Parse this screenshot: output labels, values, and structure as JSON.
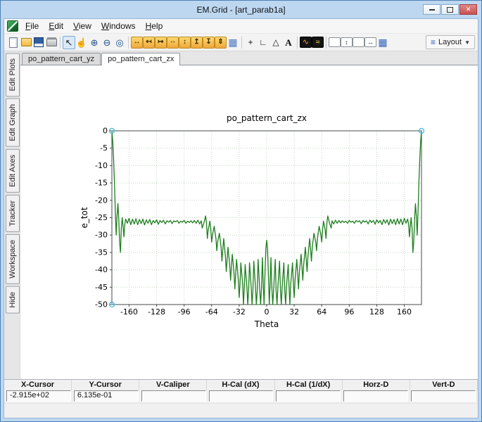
{
  "window": {
    "title": "EM.Grid - [art_parab1a]",
    "controls": {
      "minimize": "min",
      "restore": "restore",
      "close": "✕"
    }
  },
  "menu": {
    "items": [
      "File",
      "Edit",
      "View",
      "Windows",
      "Help"
    ]
  },
  "toolbar": {
    "groups": [
      [
        {
          "name": "new-document-icon",
          "kind": "page"
        },
        {
          "name": "open-folder-icon",
          "kind": "folder"
        },
        {
          "name": "save-icon",
          "kind": "floppy"
        },
        {
          "name": "print-icon",
          "kind": "printer"
        }
      ],
      [
        {
          "name": "select-arrow-icon",
          "glyph": "↖",
          "cls": "dark",
          "active": true
        },
        {
          "name": "pan-hand-icon",
          "glyph": "☝",
          "cls": "dark"
        },
        {
          "name": "zoom-in-icon",
          "glyph": "⊕",
          "cls": "blue"
        },
        {
          "name": "zoom-out-icon",
          "glyph": "⊖",
          "cls": "blue"
        },
        {
          "name": "zoom-window-icon",
          "glyph": "◎",
          "cls": "blue"
        }
      ],
      [
        {
          "name": "fit-x-icon",
          "glyph": "↔",
          "cls": "orange"
        },
        {
          "name": "shift-x-left-icon",
          "glyph": "↤",
          "cls": "orange"
        },
        {
          "name": "shift-x-right-icon",
          "glyph": "↦",
          "cls": "orange"
        },
        {
          "name": "expand-x-icon",
          "glyph": "⇔",
          "cls": "orange"
        },
        {
          "name": "fit-y-icon",
          "glyph": "↕",
          "cls": "orange"
        },
        {
          "name": "shift-y-up-icon",
          "glyph": "↥",
          "cls": "orange"
        },
        {
          "name": "shift-y-down-icon",
          "glyph": "↧",
          "cls": "orange"
        },
        {
          "name": "expand-y-icon",
          "glyph": "⇕",
          "cls": "orange"
        },
        {
          "name": "data-table-icon",
          "glyph": "▦",
          "cls": "table"
        }
      ],
      [
        {
          "name": "crosshair-icon",
          "glyph": "+",
          "cls": "plain"
        },
        {
          "name": "axes-icon",
          "glyph": "∟",
          "cls": "plain"
        },
        {
          "name": "marker-triangle-icon",
          "glyph": "△",
          "cls": "plain"
        },
        {
          "name": "text-annotation-icon",
          "glyph": "A",
          "cls": "serif"
        }
      ],
      [
        {
          "name": "colormap-icon",
          "glyph": "∿",
          "cls": "darkbox"
        },
        {
          "name": "spectrum-icon",
          "glyph": "≈",
          "cls": "darkbox yellow"
        }
      ],
      [
        {
          "name": "frame-icon",
          "glyph": "",
          "cls": "framebox"
        },
        {
          "name": "fit-frame-vertical-icon",
          "glyph": "↕",
          "cls": "framebox"
        },
        {
          "name": "frame-wide-icon",
          "glyph": "",
          "cls": "framebox"
        },
        {
          "name": "fit-frame-horizontal-icon",
          "glyph": "↔",
          "cls": "framebox"
        },
        {
          "name": "grid-layout-icon",
          "glyph": "▦",
          "cls": "bluetable"
        }
      ]
    ],
    "layout": {
      "icon": "≡",
      "label": "Layout",
      "arrow": "▼"
    }
  },
  "sidebar": {
    "tabs": [
      "Edit Plots",
      "Edit Graph",
      "Edit Axes",
      "Tracker",
      "Workspace",
      "Hide"
    ]
  },
  "document_tabs": [
    {
      "label": "po_pattern_cart_yz",
      "active": false
    },
    {
      "label": "po_pattern_cart_zx",
      "active": true
    }
  ],
  "chart_data": {
    "type": "line",
    "title": "po_pattern_cart_zx",
    "xlabel": "Theta",
    "ylabel": "e_tot",
    "xlim": [
      -180,
      180
    ],
    "ylim": [
      -50,
      0
    ],
    "xticks": [
      -160,
      -128,
      -96,
      -64,
      -32,
      0,
      32,
      64,
      96,
      128,
      160
    ],
    "yticks": [
      0,
      -5,
      -10,
      -15,
      -20,
      -25,
      -30,
      -35,
      -40,
      -45,
      -50
    ],
    "grid": true,
    "legend": "none",
    "series": [
      {
        "name": "e_tot",
        "color": "#1e7e1e",
        "points": [
          [
            -180,
            0
          ],
          [
            -179,
            -3
          ],
          [
            -178,
            -8
          ],
          [
            -177,
            -15
          ],
          [
            -176,
            -23.5
          ],
          [
            -175,
            -30
          ],
          [
            -174,
            -24.5
          ],
          [
            -173,
            -21
          ],
          [
            -172,
            -25.5
          ],
          [
            -171,
            -32
          ],
          [
            -170,
            -35
          ],
          [
            -169,
            -28
          ],
          [
            -168,
            -25
          ],
          [
            -167,
            -27.5
          ],
          [
            -166,
            -30.5
          ],
          [
            -165,
            -27
          ],
          [
            -164,
            -25.4
          ],
          [
            -162,
            -26.6
          ],
          [
            -160,
            -25.2
          ],
          [
            -158,
            -27
          ],
          [
            -156,
            -25.4
          ],
          [
            -154,
            -26.8
          ],
          [
            -152,
            -25.3
          ],
          [
            -150,
            -27
          ],
          [
            -148,
            -25.5
          ],
          [
            -146,
            -26.7
          ],
          [
            -144,
            -25.4
          ],
          [
            -142,
            -27.1
          ],
          [
            -140,
            -25.6
          ],
          [
            -138,
            -26.6
          ],
          [
            -136,
            -25.5
          ],
          [
            -134,
            -27
          ],
          [
            -132,
            -25.8
          ],
          [
            -130,
            -26.5
          ],
          [
            -128,
            -25.6
          ],
          [
            -126,
            -26.9
          ],
          [
            -124,
            -25.8
          ],
          [
            -122,
            -26.4
          ],
          [
            -120,
            -25.7
          ],
          [
            -118,
            -26.8
          ],
          [
            -116,
            -25.9
          ],
          [
            -114,
            -26.3
          ],
          [
            -112,
            -25.8
          ],
          [
            -110,
            -26.7
          ],
          [
            -108,
            -25.9
          ],
          [
            -106,
            -26.2
          ],
          [
            -104,
            -25.8
          ],
          [
            -102,
            -26.6
          ],
          [
            -100,
            -26
          ],
          [
            -98,
            -26.3
          ],
          [
            -96,
            -25.8
          ],
          [
            -94,
            -26.6
          ],
          [
            -92,
            -26
          ],
          [
            -90,
            -26.4
          ],
          [
            -88,
            -25.9
          ],
          [
            -86,
            -26.5
          ],
          [
            -84,
            -25.8
          ],
          [
            -82,
            -26.6
          ],
          [
            -80,
            -25.7
          ],
          [
            -78,
            -26.8
          ],
          [
            -76,
            -25.9
          ],
          [
            -75,
            -28
          ],
          [
            -73,
            -26.5
          ],
          [
            -71,
            -24.5
          ],
          [
            -70,
            -26.5
          ],
          [
            -69,
            -31
          ],
          [
            -68,
            -28.5
          ],
          [
            -66,
            -26
          ],
          [
            -65,
            -28.5
          ],
          [
            -64,
            -32
          ],
          [
            -63,
            -30
          ],
          [
            -61,
            -27.5
          ],
          [
            -59,
            -31
          ],
          [
            -58,
            -34.5
          ],
          [
            -57,
            -32
          ],
          [
            -55,
            -29.5
          ],
          [
            -53,
            -33.5
          ],
          [
            -52,
            -37.5
          ],
          [
            -51,
            -34
          ],
          [
            -50,
            -31
          ],
          [
            -48,
            -36
          ],
          [
            -47,
            -40.5
          ],
          [
            -46,
            -37
          ],
          [
            -45,
            -33.5
          ],
          [
            -43,
            -38.5
          ],
          [
            -42,
            -43
          ],
          [
            -41,
            -39
          ],
          [
            -40,
            -35.5
          ],
          [
            -38,
            -41
          ],
          [
            -37,
            -45.5
          ],
          [
            -36,
            -41
          ],
          [
            -35,
            -37
          ],
          [
            -33,
            -43
          ],
          [
            -32,
            -48
          ],
          [
            -31,
            -44
          ],
          [
            -30,
            -38
          ],
          [
            -28,
            -44
          ],
          [
            -27,
            -50
          ],
          [
            -26,
            -45
          ],
          [
            -25,
            -38.5
          ],
          [
            -23,
            -45
          ],
          [
            -22,
            -50
          ],
          [
            -21,
            -46
          ],
          [
            -20,
            -38
          ],
          [
            -18,
            -45
          ],
          [
            -17,
            -50
          ],
          [
            -16,
            -46
          ],
          [
            -15,
            -37.5
          ],
          [
            -13,
            -45
          ],
          [
            -12,
            -50
          ],
          [
            -11,
            -46
          ],
          [
            -10,
            -37
          ],
          [
            -8,
            -46
          ],
          [
            -7,
            -50
          ],
          [
            -6,
            -45
          ],
          [
            -5,
            -36.5
          ],
          [
            -4,
            -44
          ],
          [
            -3,
            -50
          ],
          [
            -2,
            -41
          ],
          [
            -1,
            -34
          ],
          [
            0,
            -31.5
          ],
          [
            1,
            -34
          ],
          [
            2,
            -41
          ],
          [
            3,
            -50
          ],
          [
            4,
            -44
          ],
          [
            5,
            -36.5
          ],
          [
            6,
            -45
          ],
          [
            7,
            -50
          ],
          [
            8,
            -46
          ],
          [
            10,
            -37
          ],
          [
            11,
            -46
          ],
          [
            12,
            -50
          ],
          [
            13,
            -45
          ],
          [
            15,
            -37.5
          ],
          [
            16,
            -46
          ],
          [
            17,
            -50
          ],
          [
            18,
            -45
          ],
          [
            20,
            -38
          ],
          [
            21,
            -46
          ],
          [
            22,
            -50
          ],
          [
            23,
            -45
          ],
          [
            25,
            -38.5
          ],
          [
            26,
            -45
          ],
          [
            27,
            -50
          ],
          [
            28,
            -44
          ],
          [
            30,
            -38
          ],
          [
            31,
            -44
          ],
          [
            32,
            -48
          ],
          [
            33,
            -43
          ],
          [
            35,
            -37
          ],
          [
            36,
            -41
          ],
          [
            37,
            -45.5
          ],
          [
            38,
            -41
          ],
          [
            40,
            -35.5
          ],
          [
            41,
            -39
          ],
          [
            42,
            -43
          ],
          [
            43,
            -38.5
          ],
          [
            45,
            -33.5
          ],
          [
            46,
            -37
          ],
          [
            47,
            -40.5
          ],
          [
            48,
            -36
          ],
          [
            50,
            -31
          ],
          [
            51,
            -34
          ],
          [
            52,
            -37.5
          ],
          [
            53,
            -33.5
          ],
          [
            55,
            -29.5
          ],
          [
            57,
            -32
          ],
          [
            58,
            -34.5
          ],
          [
            59,
            -31
          ],
          [
            61,
            -27.5
          ],
          [
            63,
            -30
          ],
          [
            64,
            -32
          ],
          [
            65,
            -28.5
          ],
          [
            66,
            -26
          ],
          [
            68,
            -28.5
          ],
          [
            69,
            -31
          ],
          [
            70,
            -26.5
          ],
          [
            71,
            -24.5
          ],
          [
            73,
            -26.5
          ],
          [
            75,
            -28
          ],
          [
            76,
            -25.9
          ],
          [
            78,
            -26.8
          ],
          [
            80,
            -25.7
          ],
          [
            82,
            -26.6
          ],
          [
            84,
            -25.8
          ],
          [
            86,
            -26.5
          ],
          [
            88,
            -25.9
          ],
          [
            90,
            -26.4
          ],
          [
            92,
            -26
          ],
          [
            94,
            -26.6
          ],
          [
            96,
            -25.8
          ],
          [
            98,
            -26.3
          ],
          [
            100,
            -26
          ],
          [
            102,
            -26.6
          ],
          [
            104,
            -25.8
          ],
          [
            106,
            -26.2
          ],
          [
            108,
            -25.9
          ],
          [
            110,
            -26.7
          ],
          [
            112,
            -25.8
          ],
          [
            114,
            -26.3
          ],
          [
            116,
            -25.9
          ],
          [
            118,
            -26.8
          ],
          [
            120,
            -25.7
          ],
          [
            122,
            -26.4
          ],
          [
            124,
            -25.8
          ],
          [
            126,
            -26.9
          ],
          [
            128,
            -25.6
          ],
          [
            130,
            -26.5
          ],
          [
            132,
            -25.8
          ],
          [
            134,
            -27
          ],
          [
            136,
            -25.5
          ],
          [
            138,
            -26.6
          ],
          [
            140,
            -25.6
          ],
          [
            142,
            -27.1
          ],
          [
            144,
            -25.4
          ],
          [
            146,
            -26.7
          ],
          [
            148,
            -25.5
          ],
          [
            150,
            -27
          ],
          [
            152,
            -25.3
          ],
          [
            154,
            -26.8
          ],
          [
            156,
            -25.4
          ],
          [
            158,
            -27
          ],
          [
            160,
            -25.2
          ],
          [
            162,
            -26.6
          ],
          [
            164,
            -25.4
          ],
          [
            165,
            -27
          ],
          [
            166,
            -30.5
          ],
          [
            167,
            -27.5
          ],
          [
            168,
            -25
          ],
          [
            169,
            -28
          ],
          [
            170,
            -35
          ],
          [
            171,
            -32
          ],
          [
            172,
            -25.5
          ],
          [
            173,
            -21
          ],
          [
            174,
            -24.5
          ],
          [
            175,
            -30
          ],
          [
            176,
            -23.5
          ],
          [
            177,
            -15
          ],
          [
            178,
            -8
          ],
          [
            179,
            -3
          ],
          [
            180,
            0
          ]
        ]
      }
    ],
    "markers": [
      {
        "x": -180,
        "y": 0
      },
      {
        "x": -180,
        "y": -50
      },
      {
        "x": 180,
        "y": 0
      }
    ]
  },
  "status_bar": {
    "columns": [
      {
        "header": "X-Cursor",
        "value": "-2.915e+02"
      },
      {
        "header": "Y-Cursor",
        "value": "6.135e-01"
      },
      {
        "header": "V-Caliper",
        "value": ""
      },
      {
        "header": "H-Cal (dX)",
        "value": ""
      },
      {
        "header": "H-Cal (1/dX)",
        "value": ""
      },
      {
        "header": "Horz-D",
        "value": ""
      },
      {
        "header": "Vert-D",
        "value": ""
      }
    ]
  },
  "colors": {
    "titlebar": "#bdd7f1",
    "curve": "#1e7e1e",
    "grid": "#c4d4c4",
    "frame": "#45484c",
    "marker": "#49b8dc"
  }
}
